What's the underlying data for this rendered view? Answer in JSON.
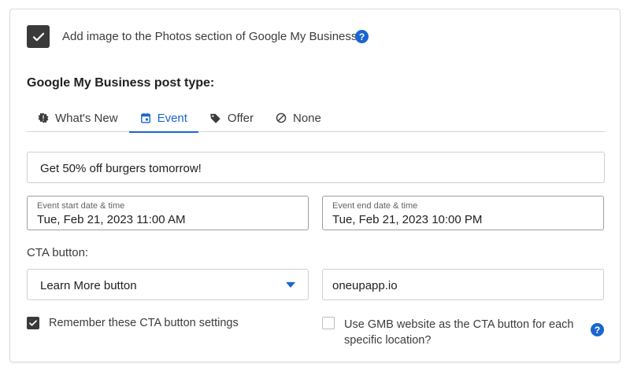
{
  "photos_option": {
    "checked": true,
    "label": "Add image to the Photos section of Google My Business?",
    "help": "?"
  },
  "post_type": {
    "title": "Google My Business post type:",
    "tabs": [
      {
        "label": "What's New",
        "icon": "burst-icon",
        "active": false
      },
      {
        "label": "Event",
        "icon": "calendar-icon",
        "active": true
      },
      {
        "label": "Offer",
        "icon": "tag-icon",
        "active": false
      },
      {
        "label": "None",
        "icon": "block-icon",
        "active": false
      }
    ]
  },
  "event": {
    "title_value": "Get 50% off burgers tomorrow!",
    "start": {
      "label": "Event start date & time",
      "value": "Tue, Feb 21, 2023 11:00 AM"
    },
    "end": {
      "label": "Event end date & time",
      "value": "Tue, Feb 21, 2023 10:00 PM"
    }
  },
  "cta": {
    "label": "CTA button:",
    "selected": "Learn More button",
    "url": "oneupapp.io",
    "remember": {
      "checked": true,
      "label": "Remember these CTA button settings"
    },
    "use_gmb_website": {
      "checked": false,
      "label": "Use GMB website as the CTA button for each specific location?"
    },
    "help": "?"
  },
  "colors": {
    "accent": "#1a66d1",
    "checkbox_dark": "#3a3a3a",
    "border": "#cfcfcf"
  }
}
